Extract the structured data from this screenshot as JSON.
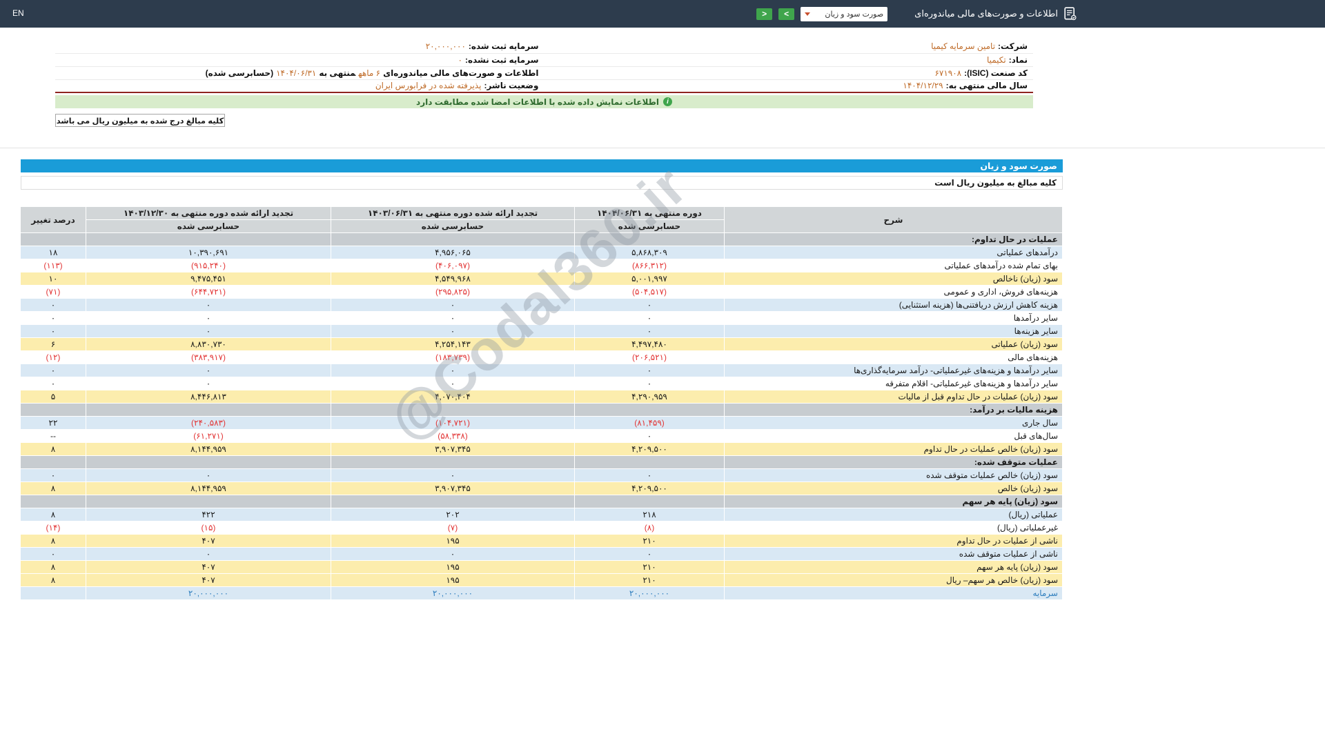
{
  "topbar": {
    "en": "EN",
    "title": "اطلاعات و صورت‌های مالی میاندوره‌ای",
    "select_value": "صورت سود و زیان",
    "next_glyph": ">",
    "prev_glyph": "<"
  },
  "company": {
    "rows": [
      {
        "right": [
          {
            "t": "شرکت:",
            "b": 1
          },
          {
            "t": "تامین سرمایه کیمیا",
            "o": 1
          }
        ],
        "left": [
          {
            "t": "سرمایه ثبت شده:",
            "b": 1
          },
          {
            "t": "۲۰,۰۰۰,۰۰۰",
            "o": 1,
            "ltr": 1
          }
        ]
      },
      {
        "right": [
          {
            "t": "نماد:",
            "b": 1
          },
          {
            "t": "تکیمیا",
            "o": 1
          }
        ],
        "left": [
          {
            "t": "سرمایه ثبت نشده:",
            "b": 1
          },
          {
            "t": "۰",
            "o": 1,
            "ltr": 1
          }
        ]
      },
      {
        "right": [
          {
            "t": "کد صنعت (ISIC):",
            "b": 1
          },
          {
            "t": "۶۷۱۹۰۸",
            "o": 1,
            "ltr": 1
          }
        ],
        "left": [
          {
            "t": "اطلاعات و صورت‌های مالی میاندوره‌ای",
            "b": 1
          },
          {
            "t": "۶ ماهه",
            "o": 1
          },
          {
            "t": "منتهی به",
            "b": 1
          },
          {
            "t": "۱۴۰۴/۰۶/۳۱",
            "o": 1,
            "ltr": 1
          },
          {
            "t": "(حسابرسی شده)",
            "b": 1
          }
        ]
      },
      {
        "right": [
          {
            "t": "سال مالی منتهی به:",
            "b": 1
          },
          {
            "t": "۱۴۰۴/۱۲/۲۹",
            "o": 1,
            "ltr": 1
          }
        ],
        "left": [
          {
            "t": "وضعیت ناشر:",
            "b": 1
          },
          {
            "t": "پذیرفته شده در فرابورس ایران",
            "o": 1
          }
        ]
      }
    ]
  },
  "banner": {
    "text": "اطلاعات نمایش داده شده با اطلاعات امضا شده مطابقت دارد"
  },
  "note": "کلیه مبالغ درج شده به میلیون ریال می باشد",
  "watermark": "@Codal360.ir",
  "statement": {
    "title": "صورت سود و زیان",
    "subtitle": "کلیه مبالغ به میلیون ریال است",
    "header": {
      "desc": "شرح",
      "col1": "دوره منتهی به ۱۴۰۴/۰۶/۳۱",
      "col2": "تجدید ارائه شده دوره منتهی به ۱۴۰۳/۰۶/۳۱",
      "col3": "تجدید ارائه شده دوره منتهی به ۱۴۰۳/۱۲/۳۰",
      "audited": "حسابرسی شده",
      "change": "درصد تغییر"
    },
    "rows": [
      {
        "type": "section",
        "desc": "عملیات در حال تداوم:"
      },
      {
        "type": "data",
        "style": "blue",
        "desc": "درآمدهای عملیاتی",
        "c1": "۵,۸۶۸,۳۰۹",
        "c2": "۴,۹۵۶,۰۶۵",
        "c3": "۱۰,۳۹۰,۶۹۱",
        "chg": "۱۸"
      },
      {
        "type": "data",
        "style": "white",
        "desc": "بهای تمام شده درآمدهای عملیاتی",
        "c1": "(۸۶۶,۳۱۲)",
        "c2": "(۴۰۶,۰۹۷)",
        "c3": "(۹۱۵,۲۴۰)",
        "chg": "(۱۱۳)"
      },
      {
        "type": "data",
        "style": "yellow",
        "desc": "سود (زیان) ناخالص",
        "c1": "۵,۰۰۱,۹۹۷",
        "c2": "۴,۵۴۹,۹۶۸",
        "c3": "۹,۴۷۵,۴۵۱",
        "chg": "۱۰"
      },
      {
        "type": "data",
        "style": "white",
        "desc": "هزینه‌های فروش، اداری و عمومی",
        "c1": "(۵۰۴,۵۱۷)",
        "c2": "(۲۹۵,۸۲۵)",
        "c3": "(۶۴۴,۷۲۱)",
        "chg": "(۷۱)"
      },
      {
        "type": "data",
        "style": "blue",
        "desc": "هزینه کاهش ارزش دریافتنی‌ها (هزینه استثنایی)",
        "c1": "۰",
        "c2": "۰",
        "c3": "۰",
        "chg": "۰"
      },
      {
        "type": "data",
        "style": "white",
        "desc": "سایر درآمدها",
        "c1": "۰",
        "c2": "۰",
        "c3": "۰",
        "chg": "۰"
      },
      {
        "type": "data",
        "style": "blue",
        "desc": "سایر هزینه‌ها",
        "c1": "۰",
        "c2": "۰",
        "c3": "۰",
        "chg": "۰"
      },
      {
        "type": "data",
        "style": "yellow",
        "desc": "سود (زیان) عملیاتی",
        "c1": "۴,۴۹۷,۴۸۰",
        "c2": "۴,۲۵۴,۱۴۳",
        "c3": "۸,۸۳۰,۷۳۰",
        "chg": "۶"
      },
      {
        "type": "data",
        "style": "white",
        "desc": "هزینه‌های مالی",
        "c1": "(۲۰۶,۵۲۱)",
        "c2": "(۱۸۳,۷۳۹)",
        "c3": "(۳۸۳,۹۱۷)",
        "chg": "(۱۲)"
      },
      {
        "type": "data",
        "style": "blue",
        "desc": "سایر درآمدها و هزینه‌های غیرعملیاتی- درآمد سرمایه‌گذاری‌ها",
        "c1": "۰",
        "c2": "۰",
        "c3": "۰",
        "chg": "۰"
      },
      {
        "type": "data",
        "style": "white",
        "desc": "سایر درآمدها و هزینه‌های غیرعملیاتی- اقلام متفرقه",
        "c1": "۰",
        "c2": "۰",
        "c3": "۰",
        "chg": "۰"
      },
      {
        "type": "data",
        "style": "yellow",
        "desc": "سود (زیان) عملیات در حال تداوم قبل از مالیات",
        "c1": "۴,۲۹۰,۹۵۹",
        "c2": "۴,۰۷۰,۴۰۴",
        "c3": "۸,۴۴۶,۸۱۳",
        "chg": "۵"
      },
      {
        "type": "section",
        "desc": "هزینه مالیات بر درآمد:"
      },
      {
        "type": "data",
        "style": "blue",
        "desc": "سال جاری",
        "c1": "(۸۱,۴۵۹)",
        "c2": "(۱۰۴,۷۲۱)",
        "c3": "(۲۴۰,۵۸۳)",
        "chg": "۲۲"
      },
      {
        "type": "data",
        "style": "white",
        "desc": "سال‌های قبل",
        "c1": "۰",
        "c2": "(۵۸,۳۳۸)",
        "c3": "(۶۱,۲۷۱)",
        "chg": "--"
      },
      {
        "type": "data",
        "style": "yellow",
        "desc": "سود (زیان) خالص عملیات در حال تداوم",
        "c1": "۴,۲۰۹,۵۰۰",
        "c2": "۳,۹۰۷,۳۴۵",
        "c3": "۸,۱۴۴,۹۵۹",
        "chg": "۸"
      },
      {
        "type": "section",
        "desc": "عملیات متوقف شده:"
      },
      {
        "type": "data",
        "style": "blue",
        "desc": "سود (زیان) خالص عملیات متوقف شده",
        "c1": "۰",
        "c2": "۰",
        "c3": "۰",
        "chg": "۰"
      },
      {
        "type": "data",
        "style": "yellow",
        "desc": "سود (زیان) خالص",
        "c1": "۴,۲۰۹,۵۰۰",
        "c2": "۳,۹۰۷,۳۴۵",
        "c3": "۸,۱۴۴,۹۵۹",
        "chg": "۸"
      },
      {
        "type": "section",
        "desc": "سود (زیان) پایه هر سهم"
      },
      {
        "type": "data",
        "style": "blue",
        "desc": "عملیاتی (ریال)",
        "c1": "۲۱۸",
        "c2": "۲۰۲",
        "c3": "۴۲۲",
        "chg": "۸"
      },
      {
        "type": "data",
        "style": "white",
        "desc": "غیرعملیاتی (ریال)",
        "c1": "(۸)",
        "c2": "(۷)",
        "c3": "(۱۵)",
        "chg": "(۱۴)"
      },
      {
        "type": "data",
        "style": "yellow",
        "desc": "ناشی از عملیات در حال تداوم",
        "c1": "۲۱۰",
        "c2": "۱۹۵",
        "c3": "۴۰۷",
        "chg": "۸"
      },
      {
        "type": "data",
        "style": "blue",
        "desc": "ناشی از عملیات متوقف شده",
        "c1": "۰",
        "c2": "۰",
        "c3": "۰",
        "chg": "۰"
      },
      {
        "type": "data",
        "style": "yellow",
        "desc": "سود (زیان) پایه هر سهم",
        "c1": "۲۱۰",
        "c2": "۱۹۵",
        "c3": "۴۰۷",
        "chg": "۸"
      },
      {
        "type": "data",
        "style": "yellow",
        "desc": "سود (زیان) خالص هر سهم– ریال",
        "c1": "۲۱۰",
        "c2": "۱۹۵",
        "c3": "۴۰۷",
        "chg": "۸"
      },
      {
        "type": "data",
        "style": "link",
        "desc": "سرمایه",
        "c1": "۲۰,۰۰۰,۰۰۰",
        "c2": "۲۰,۰۰۰,۰۰۰",
        "c3": "۲۰,۰۰۰,۰۰۰",
        "chg": ""
      }
    ]
  },
  "colors": {
    "header_navy": "#2d3c4d",
    "button_green": "#3fa54c",
    "accent_blue": "#1a9cd8",
    "value_orange": "#bf6b28",
    "negative_red": "#e23434",
    "highlight_yellow": "#fcedad",
    "row_blue": "#d9e8f4",
    "banner_green": "#d8eccb"
  }
}
